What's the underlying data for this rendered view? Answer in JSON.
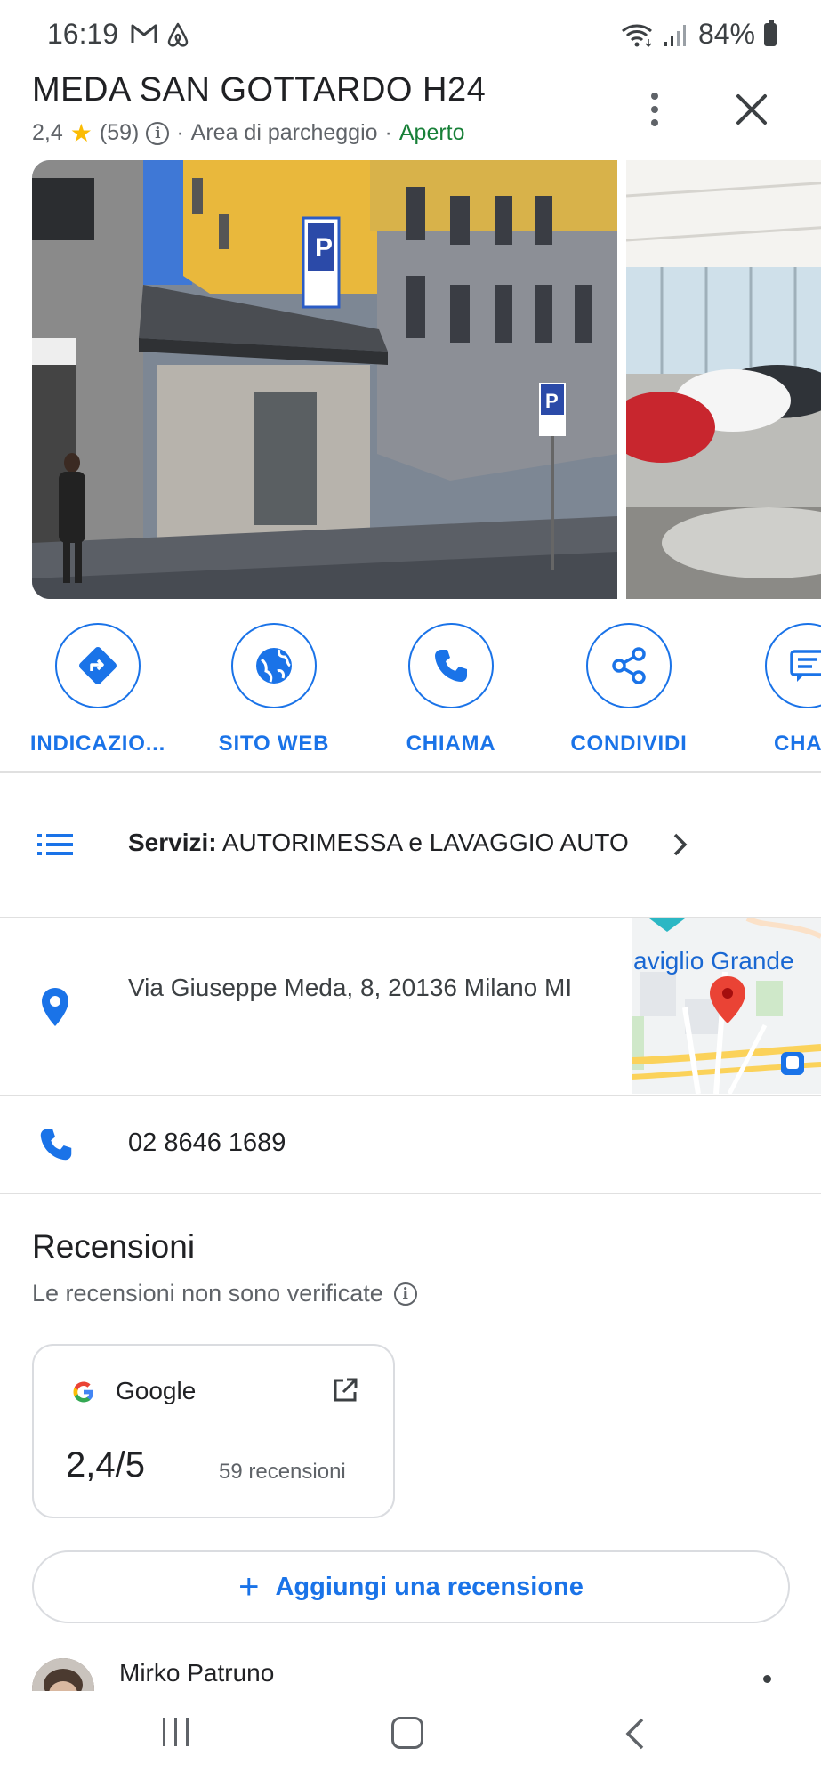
{
  "status_bar": {
    "time": "16:19",
    "left_icons": [
      "gmail-icon",
      "airbnb-icon"
    ],
    "right_icons": [
      "wifi-icon",
      "signal-icon",
      "battery-icon"
    ],
    "battery": "84%"
  },
  "place": {
    "name": "MEDA SAN GOTTARDO H24",
    "rating": "2,4",
    "review_count": "(59)",
    "category": "Area di parcheggio",
    "status": "Aperto",
    "separator": "·"
  },
  "actions": [
    {
      "label": "INDICAZIO...",
      "icon": "directions-icon"
    },
    {
      "label": "SITO WEB",
      "icon": "globe-icon"
    },
    {
      "label": "CHIAMA",
      "icon": "phone-icon"
    },
    {
      "label": "CONDIVIDI",
      "icon": "share-icon"
    },
    {
      "label": "CHA",
      "icon": "chat-icon"
    }
  ],
  "services": {
    "prefix": "Servizi:",
    "value": "AUTORIMESSA e LAVAGGIO AUTO"
  },
  "address": {
    "text": "Via Giuseppe Meda, 8, 20136 Milano MI",
    "map_label": "aviglio Grande"
  },
  "phone": {
    "number": "02 8646 1689"
  },
  "reviews": {
    "title": "Recensioni",
    "subtitle": "Le recensioni non sono verificate",
    "google": {
      "logo": "G",
      "name": "Google",
      "score": "2,4/5",
      "count": "59 recensioni"
    },
    "add_label": "Aggiungi una recensione",
    "add_icon": "+",
    "first_reviewer": "Mirko Patruno"
  },
  "colors": {
    "accent": "#1a73e8",
    "open": "#188038",
    "star": "#fbbc04",
    "pin_red": "#ea4335"
  }
}
